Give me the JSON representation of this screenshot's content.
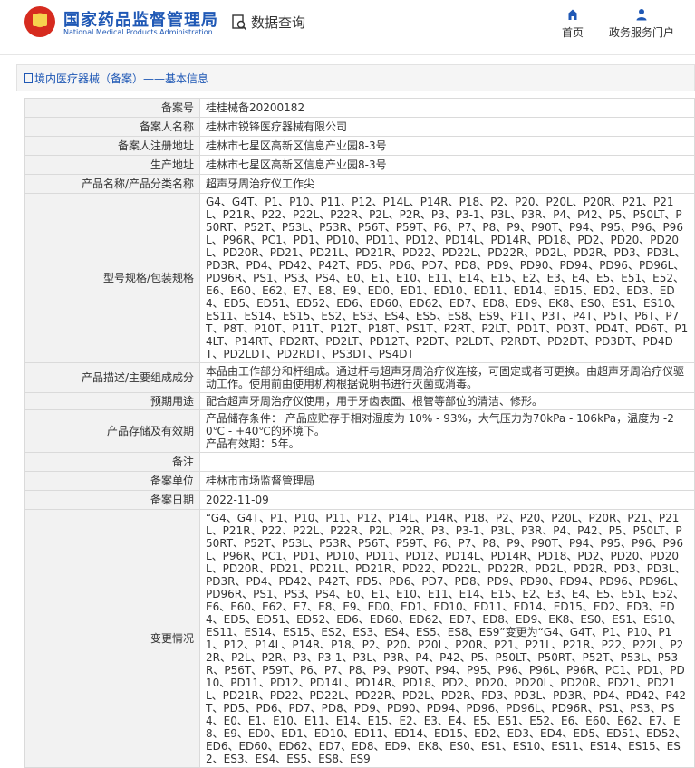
{
  "header": {
    "brand_cn": "国家药品监督管理局",
    "brand_en": "National Medical Products Administration",
    "query_label": "数据查询",
    "nav_home": "首页",
    "nav_portal": "政务服务门户",
    "accent": "#1f58b5"
  },
  "breadcrumb": "境内医疗器械（备案）——基本信息",
  "rows": [
    {
      "k": "备案号",
      "v": "桂桂械备20200182"
    },
    {
      "k": "备案人名称",
      "v": "桂林市锐锋医疗器械有限公司"
    },
    {
      "k": "备案人注册地址",
      "v": "桂林市七星区高新区信息产业园8-3号"
    },
    {
      "k": "生产地址",
      "v": "桂林市七星区高新区信息产业园8-3号"
    },
    {
      "k": "产品名称/产品分类名称",
      "v": "超声牙周治疗仪工作尖"
    },
    {
      "k": "型号规格/包装规格",
      "v": "G4、G4T、P1、P10、P11、P12、P14L、P14R、P18、P2、P20、P20L、P20R、P21、P21L、P21R、P22、P22L、P22R、P2L、P2R、P3、P3-1、P3L、P3R、P4、P42、P5、P50LT、P50RT、P52T、P53L、P53R、P56T、P59T、P6、P7、P8、P9、P90T、P94、P95、P96、P96L、P96R、PC1、PD1、PD10、PD11、PD12、PD14L、PD14R、PD18、PD2、PD20、PD20L、PD20R、PD21、PD21L、PD21R、PD22、PD22L、PD22R、PD2L、PD2R、PD3、PD3L、PD3R、PD4、PD42、P42T、PD5、PD6、PD7、PD8、PD9、PD90、PD94、PD96、PD96L、PD96R、PS1、PS3、PS4、E0、E1、E10、E11、E14、E15、E2、E3、E4、E5、E51、E52、E6、E60、E62、E7、E8、E9、ED0、ED1、ED10、ED11、ED14、ED15、ED2、ED3、ED4、ED5、ED51、ED52、ED6、ED60、ED62、ED7、ED8、ED9、EK8、ES0、ES1、ES10、ES11、ES14、ES15、ES2、ES3、ES4、ES5、ES8、ES9、P1T、P3T、P4T、P5T、P6T、P7T、P8T、P10T、P11T、P12T、P18T、PS1T、P2RT、P2LT、PD1T、PD3T、PD4T、PD6T、P14LT、P14RT、PD2RT、PD2LT、PD12T、P2DT、P2LDT、P2RDT、PD2DT、PD3DT、PD4DT、PD2LDT、PD2RDT、PS3DT、PS4DT"
    },
    {
      "k": "产品描述/主要组成成分",
      "v": "本品由工作部分和杆组成。通过杆与超声牙周治疗仪连接，可固定或者可更换。由超声牙周治疗仪驱动工作。使用前由使用机构根据说明书进行灭菌或消毒。"
    },
    {
      "k": "预期用途",
      "v": "配合超声牙周治疗仪使用，用于牙齿表面、根管等部位的清洁、修形。"
    },
    {
      "k": "产品存储及有效期",
      "v": "产品储存条件： 产品应贮存于相对湿度为 10% - 93%，大气压力为70kPa - 106kPa，温度为 -20℃ - +40℃的环境下。\n产品有效期：5年。"
    },
    {
      "k": "备注",
      "v": ""
    },
    {
      "k": "备案单位",
      "v": "桂林市市场监督管理局"
    },
    {
      "k": "备案日期",
      "v": "2022-11-09"
    },
    {
      "k": "变更情况",
      "v": "“G4、G4T、P1、P10、P11、P12、P14L、P14R、P18、P2、P20、P20L、P20R、P21、P21L、P21R、P22、P22L、P22R、P2L、P2R、P3、P3-1、P3L、P3R、P4、P42、P5、P50LT、P50RT、P52T、P53L、P53R、P56T、P59T、P6、P7、P8、P9、P90T、P94、P95、P96、P96L、P96R、PC1、PD1、PD10、PD11、PD12、PD14L、PD14R、PD18、PD2、PD20、PD20L、PD20R、PD21、PD21L、PD21R、PD22、PD22L、PD22R、PD2L、PD2R、PD3、PD3L、PD3R、PD4、PD42、P42T、PD5、PD6、PD7、PD8、PD9、PD90、PD94、PD96、PD96L、PD96R、PS1、PS3、PS4、E0、E1、E10、E11、E14、E15、E2、E3、E4、E5、E51、E52、E6、E60、E62、E7、E8、E9、ED0、ED1、ED10、ED11、ED14、ED15、ED2、ED3、ED4、ED5、ED51、ED52、ED6、ED60、ED62、ED7、ED8、ED9、EK8、ES0、ES1、ES10、ES11、ES14、ES15、ES2、ES3、ES4、ES5、ES8、ES9”变更为“G4、G4T、P1、P10、P11、P12、P14L、P14R、P18、P2、P20、P20L、P20R、P21、P21L、P21R、P22、P22L、P22R、P2L、P2R、P3、P3-1、P3L、P3R、P4、P42、P5、P50LT、P50RT、P52T、P53L、P53R、P56T、P59T、P6、P7、P8、P9、P90T、P94、P95、P96、P96L、P96R、PC1、PD1、PD10、PD11、PD12、PD14L、PD14R、PD18、PD2、PD20、PD20L、PD20R、PD21、PD21L、PD21R、PD22、PD22L、PD22R、PD2L、PD2R、PD3、PD3L、PD3R、PD4、PD42、P42T、PD5、PD6、PD7、PD8、PD9、PD90、PD94、PD96、PD96L、PD96R、PS1、PS3、PS4、E0、E1、E10、E11、E14、E15、E2、E3、E4、E5、E51、E52、E6、E60、E62、E7、E8、E9、ED0、ED1、ED10、ED11、ED14、ED15、ED2、ED3、ED4、ED5、ED51、ED52、ED6、ED60、ED62、ED7、ED8、ED9、EK8、ES0、ES1、ES10、ES11、ES14、ES15、ES2、ES3、ES4、ES5、ES8、ES9"
    }
  ]
}
